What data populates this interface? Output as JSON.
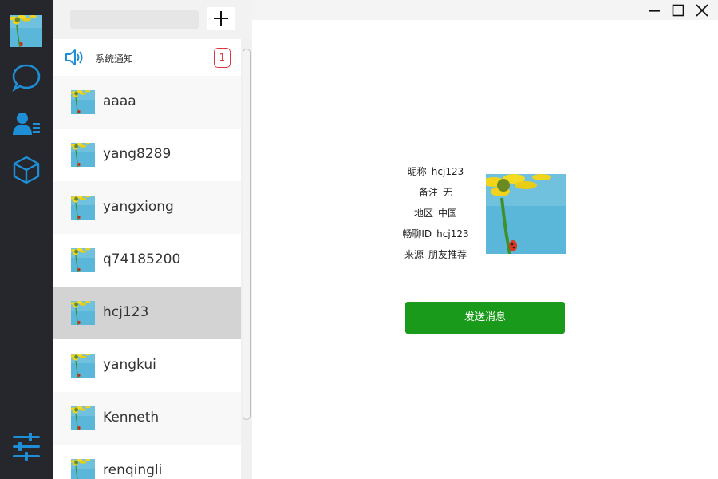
{
  "nav": {
    "icons": [
      "user-avatar",
      "chat-bubble-icon",
      "contacts-icon",
      "cube-icon",
      "settings-sliders-icon"
    ],
    "accent_color": "#1e8fd6"
  },
  "contact_list": {
    "search": {
      "value": "",
      "placeholder": ""
    },
    "add_button_icon": "plus-icon",
    "notice": {
      "label": "系统通知",
      "count": "1",
      "icon": "speaker-icon"
    },
    "contacts": [
      {
        "name": "aaaa"
      },
      {
        "name": "yang8289"
      },
      {
        "name": "yangxiong"
      },
      {
        "name": "q74185200"
      },
      {
        "name": "hcj123",
        "selected": true
      },
      {
        "name": "yangkui"
      },
      {
        "name": "Kenneth"
      },
      {
        "name": "renqingli"
      }
    ]
  },
  "window_controls": [
    "minimize-icon",
    "maximize-icon",
    "close-icon"
  ],
  "profile": {
    "nickname_label": "昵称",
    "nickname": "hcj123",
    "remark_label": "备注",
    "remark": "无",
    "region_label": "地区",
    "region": "中国",
    "id_label": "畅聊ID",
    "id": "hcj123",
    "source_label": "来源",
    "source": "朋友推荐",
    "send_button": "发送消息",
    "send_button_color": "#1a9a1a"
  }
}
